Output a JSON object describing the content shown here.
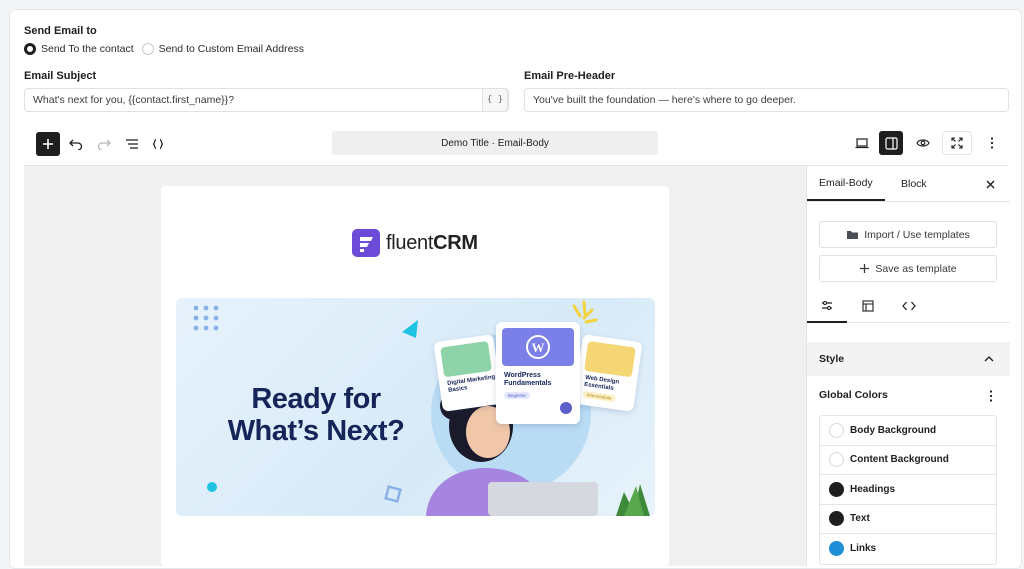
{
  "send_to": {
    "heading": "Send Email to",
    "options": [
      {
        "label": "Send To the contact",
        "selected": true
      },
      {
        "label": "Send to Custom Email Address",
        "selected": false
      }
    ]
  },
  "subject": {
    "label": "Email Subject",
    "value": "What's next for you, {{contact.first_name}}?",
    "merge_icon": "{ }"
  },
  "preheader": {
    "label": "Email Pre-Header",
    "value": "You've built the foundation — here's where to go deeper."
  },
  "toolbar": {
    "doc_title": "Demo Title · Email-Body",
    "left_icons": [
      "plus-icon",
      "undo-icon",
      "redo-icon",
      "list-view-icon",
      "code-braces-icon"
    ],
    "right_icons": [
      "desktop-preview-icon",
      "sidebar-toggle-icon",
      "eye-icon",
      "fullscreen-icon",
      "more-vertical-icon"
    ]
  },
  "email": {
    "logo_text_light": "fluent",
    "logo_text_bold": "CRM",
    "hero_title": "Ready for What’s Next?",
    "cards": [
      {
        "title": "Digital Marketing Basics",
        "tag": "",
        "color": "#8fd3a8"
      },
      {
        "title": "WordPress Fundamentals",
        "tag": "Beginner",
        "color": "#7b7fe8"
      },
      {
        "title": "Web Design Essentials",
        "tag": "Intermediate",
        "color": "#f4d675"
      }
    ]
  },
  "panel": {
    "tabs": [
      "Email-Body",
      "Block"
    ],
    "import_label": "Import / Use templates",
    "save_label": "Save as template",
    "style_label": "Style",
    "global_colors_label": "Global Colors",
    "colors": [
      {
        "name": "Body Background",
        "color": "#ffffff"
      },
      {
        "name": "Content Background",
        "color": "#ffffff"
      },
      {
        "name": "Headings",
        "color": "#1e1e1e"
      },
      {
        "name": "Text",
        "color": "#1e1e1e"
      },
      {
        "name": "Links",
        "color": "#1e8fd6"
      }
    ]
  },
  "accent_color": "#6c4bd8"
}
